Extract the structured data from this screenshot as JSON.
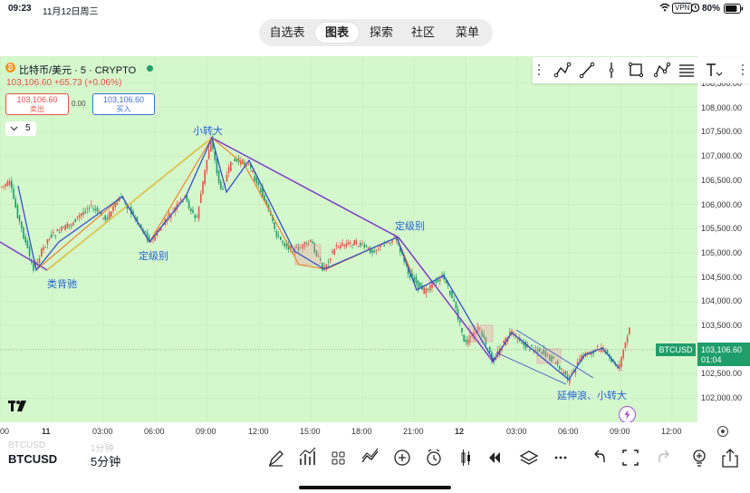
{
  "status_bar": {
    "time": "09:23",
    "date": "11月12日周三",
    "vpn": "VPN",
    "battery": "80%"
  },
  "top_tabs": [
    {
      "label": "自选表",
      "active": false
    },
    {
      "label": "图表",
      "active": true
    },
    {
      "label": "探索",
      "active": false
    },
    {
      "label": "社区",
      "active": false
    },
    {
      "label": "菜单",
      "active": false
    }
  ],
  "symbol_header": {
    "title": "比特币/美元 · 5 · CRYPTO",
    "last_price": "103,106.60",
    "change": "+65.73 (+0.06%)"
  },
  "trade_panel": {
    "sell_price": "103,106.60",
    "sell_label": "卖出",
    "spread": "0.00",
    "buy_price": "103,106.60",
    "buy_label": "买入"
  },
  "interval_selector": {
    "value": "5"
  },
  "price_axis": {
    "labels": [
      "108,500.00",
      "108,000.00",
      "107,500.00",
      "107,000.00",
      "106,500.00",
      "106,000.00",
      "105,500.00",
      "105,000.00",
      "104,500.00",
      "104,000.00",
      "103,500.00",
      "103,000.00",
      "102,500.00",
      "102,000.00"
    ],
    "current_tag_price": "103,106.60",
    "current_tag_time": "01:04",
    "symbol_tag": "BTCUSD"
  },
  "time_axis": {
    "labels": [
      "00",
      "11",
      "03:00",
      "06:00",
      "09:00",
      "12:00",
      "15:00",
      "18:00",
      "21:00",
      "12",
      "03:00",
      "06:00",
      "09:00",
      "12:00"
    ]
  },
  "annotations": {
    "small_reversal_top": "小转大",
    "divergence": "类背驰",
    "level_left": "定级别",
    "level_right": "定级别",
    "extension": "延伸浪、",
    "small_reversal_bottom": "小转大"
  },
  "bottom_bar": {
    "symbol": "BTCUSD",
    "interval": "5分钟",
    "ghost_symbol": "BTCUSD",
    "ghost_interval": "1分钟"
  },
  "colors": {
    "chart_bg": "#d4f7cc",
    "up_candle": "#e8524a",
    "down_candle": "#1f9e6a",
    "line_purple": "#7d3cc8",
    "line_blue": "#3550c8",
    "line_orange": "#f0832a",
    "line_yellow": "#f5d51e",
    "price_tag": "#1f9e6a",
    "annotation_text": "#2563d6"
  }
}
